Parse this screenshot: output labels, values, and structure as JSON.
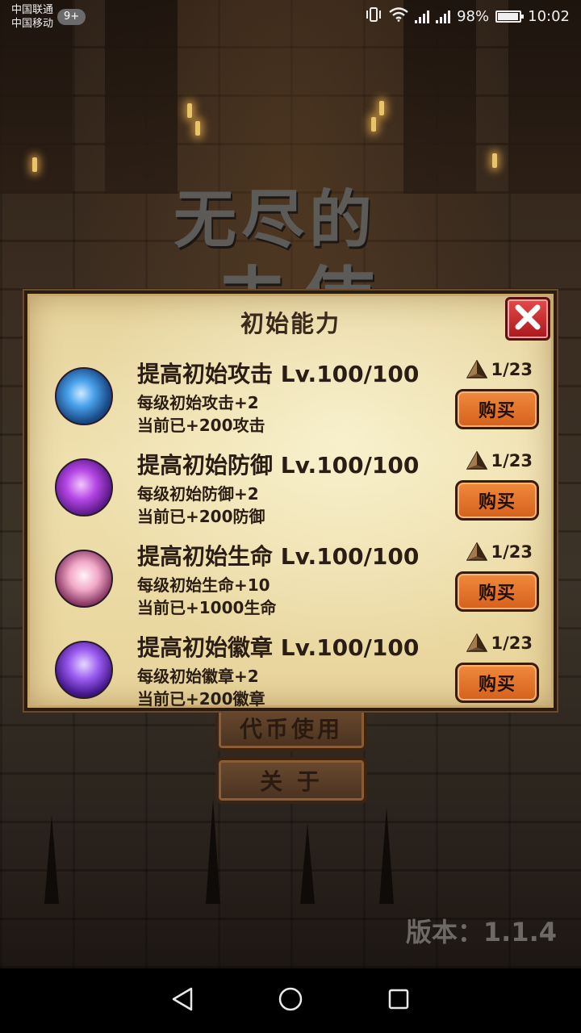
{
  "status_bar": {
    "carrier_1": "中国联通",
    "carrier_2": "中国移动",
    "notification_badge": "9+",
    "battery": "98%",
    "time": "10:02",
    "icons": [
      "vibrate-icon",
      "wifi-icon",
      "signal-3g-icon",
      "signal-2g-icon",
      "battery-icon"
    ]
  },
  "background": {
    "title_line_1": "无尽的",
    "title_line_2": "一击使",
    "menu_buttons": [
      "代币使用",
      "关 于"
    ],
    "version": "版本：1.1.4"
  },
  "dialog": {
    "title": "初始能力",
    "close_icon": "close-x-icon",
    "items": [
      {
        "name": "提高初始攻击 Lv.100/100",
        "desc1": "每级初始攻击+2",
        "desc2": "当前已+200攻击",
        "cost": "1/23",
        "buy_label": "购买",
        "icon": "attack-skill-icon",
        "icon_color": "#2f7fd0"
      },
      {
        "name": "提高初始防御 Lv.100/100",
        "desc1": "每级初始防御+2",
        "desc2": "当前已+200防御",
        "cost": "1/23",
        "buy_label": "购买",
        "icon": "defense-skill-icon",
        "icon_color": "#a236d8"
      },
      {
        "name": "提高初始生命 Lv.100/100",
        "desc1": "每级初始生命+10",
        "desc2": "当前已+1000生命",
        "cost": "1/23",
        "buy_label": "购买",
        "icon": "life-skill-icon",
        "icon_color": "#e98ab6"
      },
      {
        "name": "提高初始徽章 Lv.100/100",
        "desc1": "每级初始徽章+2",
        "desc2": "当前已+200徽章",
        "cost": "1/23",
        "buy_label": "购买",
        "icon": "badge-skill-icon",
        "icon_color": "#7a3fe0"
      }
    ]
  },
  "nav_bar": {
    "icons": [
      "back-icon",
      "home-icon",
      "recents-icon"
    ]
  }
}
